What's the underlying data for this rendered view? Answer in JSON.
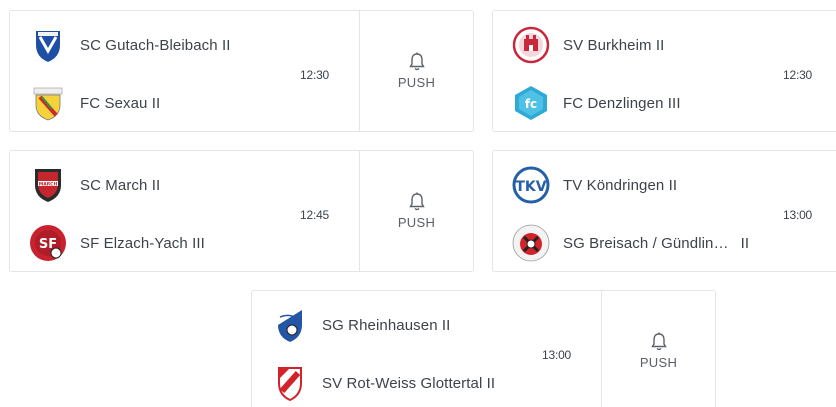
{
  "colors": {
    "border": "#e3e5e8",
    "text": "#3c434a",
    "background": "#ffffff"
  },
  "matches": [
    {
      "home": {
        "name": "SC Gutach-Bleibach II",
        "logo": "gutach-crest-icon"
      },
      "away": {
        "name": "FC Sexau II",
        "logo": "sexau-crest-icon"
      },
      "time": "12:30",
      "push_label": "PUSH"
    },
    {
      "home": {
        "name": "SV Burkheim II",
        "logo": "burkheim-crest-icon"
      },
      "away": {
        "name": "FC Denzlingen III",
        "logo": "denzlingen-crest-icon"
      },
      "time": "12:30"
    },
    {
      "home": {
        "name": "SC March II",
        "logo": "march-crest-icon"
      },
      "away": {
        "name": "SF Elzach-Yach III",
        "logo": "elzach-crest-icon"
      },
      "time": "12:45",
      "push_label": "PUSH"
    },
    {
      "home": {
        "name": "TV Köndringen II",
        "logo": "koendringen-crest-icon"
      },
      "away": {
        "name": "SG Breisach / Gündlin…",
        "suffix": "II",
        "logo": "breisach-crest-icon"
      },
      "time": "13:00"
    },
    {
      "home": {
        "name": "SG Rheinhausen II",
        "logo": "rheinhausen-crest-icon"
      },
      "away": {
        "name": "SV Rot-Weiss Glottertal II",
        "logo": "glottertal-crest-icon"
      },
      "time": "13:00",
      "push_label": "PUSH"
    }
  ]
}
